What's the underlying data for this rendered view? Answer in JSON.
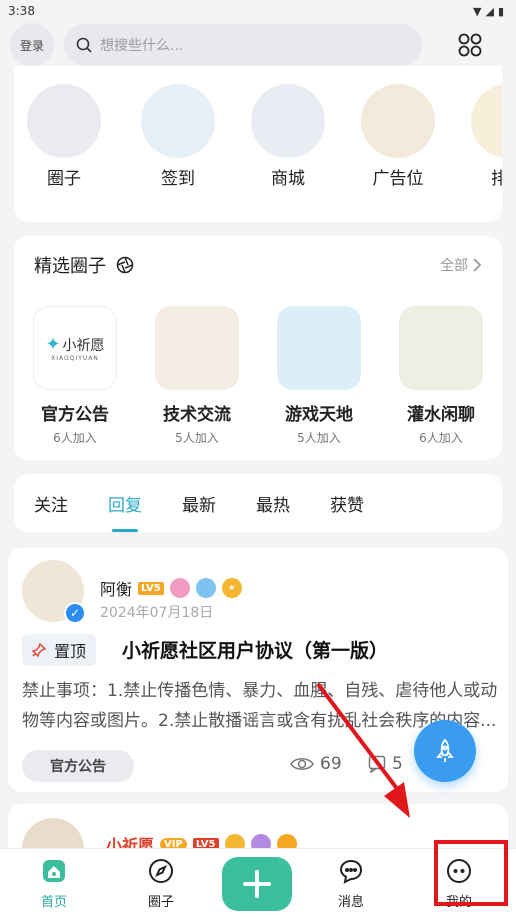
{
  "status_bar": {
    "time": "3:38"
  },
  "header": {
    "login_label": "登录",
    "search_placeholder": "想搜些什么..."
  },
  "quick_nav": [
    {
      "label": "圈子",
      "color": "#ece9f1"
    },
    {
      "label": "签到",
      "color": "#e6f0f7"
    },
    {
      "label": "商城",
      "color": "#e9edf3"
    },
    {
      "label": "广告位",
      "color": "#f4eadb"
    },
    {
      "label": "排行",
      "color": "#f7efd9"
    }
  ],
  "featured": {
    "title": "精选圈子",
    "see_all": "全部",
    "circles": [
      {
        "name": "官方公告",
        "count": "6人加入",
        "logo_text": "小祈愿",
        "sub_text": "XIAOQIYUAN",
        "color": "#ffffff"
      },
      {
        "name": "技术交流",
        "count": "5人加入",
        "color": "#f3ede4"
      },
      {
        "name": "游戏天地",
        "count": "5人加入",
        "color": "#dceef8"
      },
      {
        "name": "灌水闲聊",
        "count": "6人加入",
        "color": "#ecefe2"
      }
    ]
  },
  "tabs": [
    "关注",
    "回复",
    "最新",
    "最热",
    "获赞"
  ],
  "post": {
    "author": "阿衡",
    "level": "LV5",
    "date": "2024年07月18日",
    "pin_label": "置顶",
    "title": "小祈愿社区用户协议（第一版）",
    "excerpt": "禁止事项：1.禁止传播色情、暴力、血腥、自残、虐待他人或动物等内容或图片。2.禁止散播谣言或含有扰乱社会秩序的内容...",
    "circle_tag": "官方公告",
    "views": "69",
    "comments": "5"
  },
  "post2": {
    "author": "小祈愿",
    "vip": "VIP",
    "level": "LV5"
  },
  "bottom_nav": [
    {
      "label": "首页"
    },
    {
      "label": "圈子"
    },
    {
      "label": "消息"
    },
    {
      "label": "我的"
    }
  ]
}
